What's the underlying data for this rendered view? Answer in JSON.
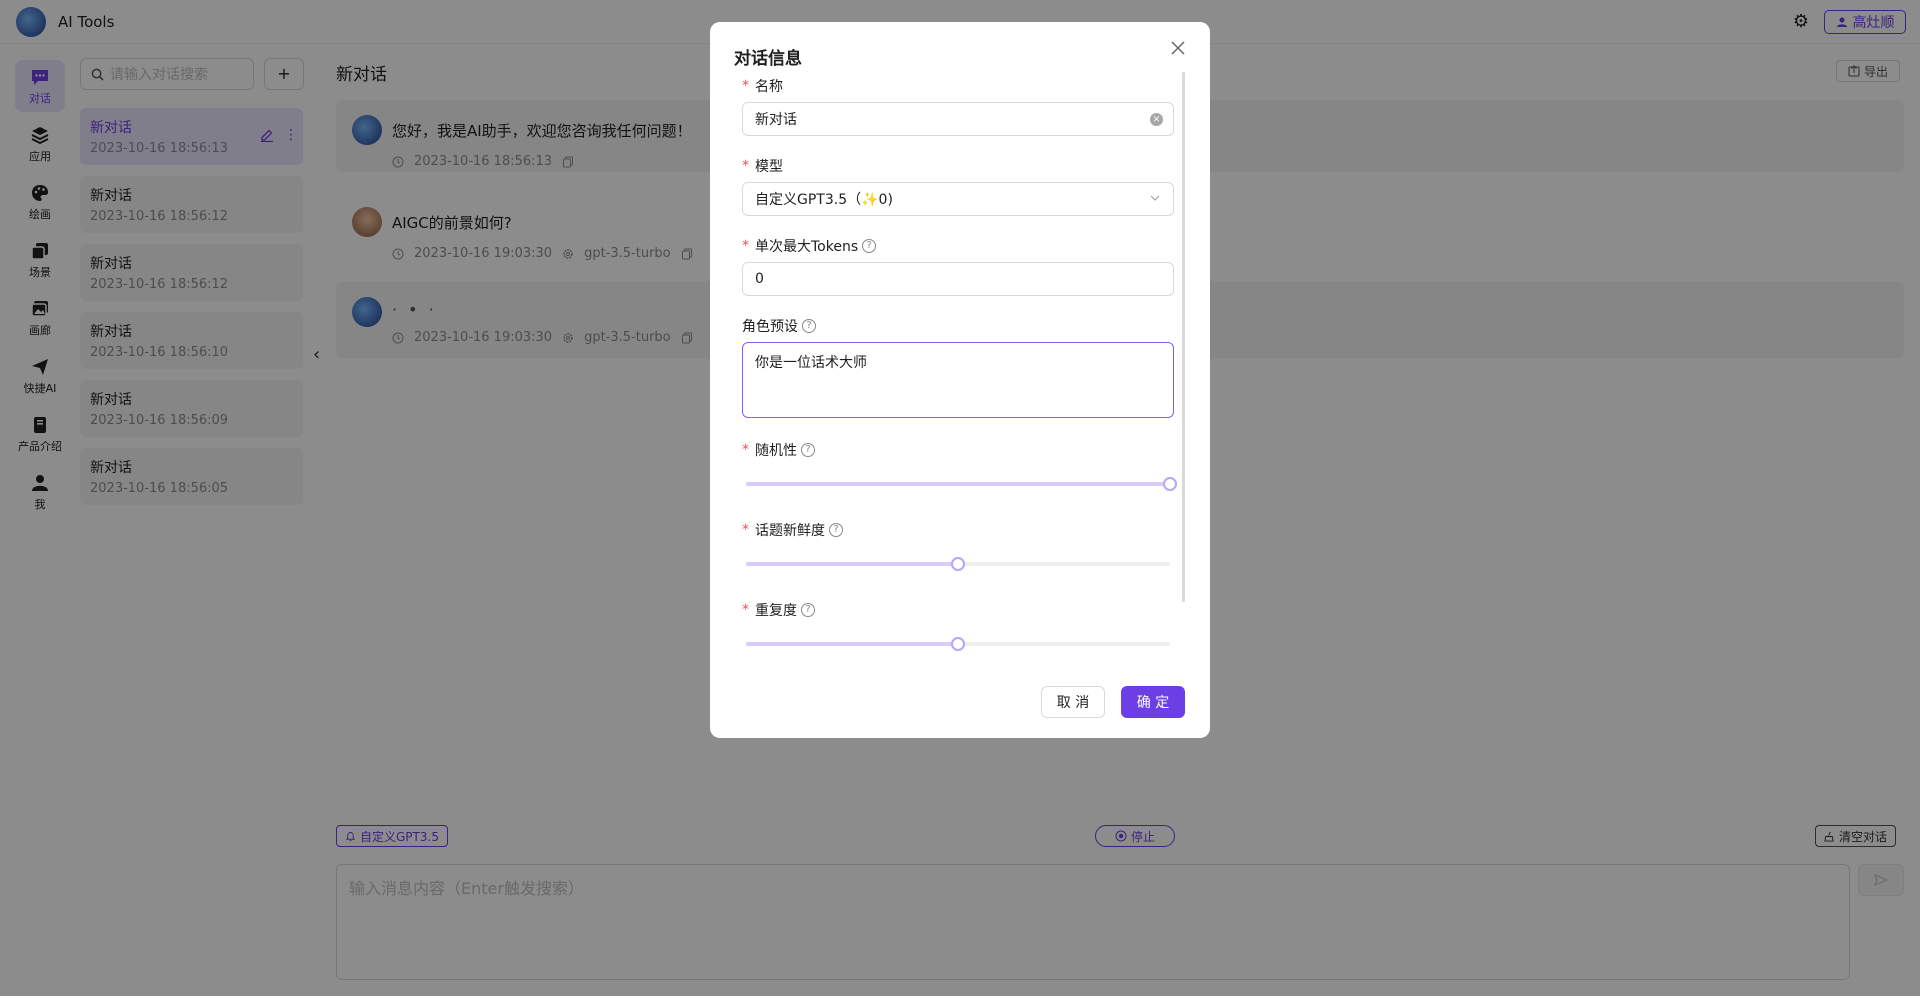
{
  "app": {
    "title": "AI Tools",
    "user_name": "高灶顺"
  },
  "rail": {
    "items": [
      {
        "label": "对话",
        "icon": "chat-icon"
      },
      {
        "label": "应用",
        "icon": "layers-icon"
      },
      {
        "label": "绘画",
        "icon": "palette-icon"
      },
      {
        "label": "场景",
        "icon": "copy-icon"
      },
      {
        "label": "画廊",
        "icon": "gallery-icon"
      },
      {
        "label": "快捷AI",
        "icon": "send-icon"
      },
      {
        "label": "产品介绍",
        "icon": "book-icon"
      },
      {
        "label": "我",
        "icon": "user-icon"
      }
    ]
  },
  "sidebar": {
    "search_placeholder": "请输入对话搜索",
    "add_label": "+",
    "conversations": [
      {
        "title": "新对话",
        "date": "2023-10-16 18:56:13"
      },
      {
        "title": "新对话",
        "date": "2023-10-16 18:56:12"
      },
      {
        "title": "新对话",
        "date": "2023-10-16 18:56:12"
      },
      {
        "title": "新对话",
        "date": "2023-10-16 18:56:10"
      },
      {
        "title": "新对话",
        "date": "2023-10-16 18:56:09"
      },
      {
        "title": "新对话",
        "date": "2023-10-16 18:56:05"
      }
    ]
  },
  "chat": {
    "title": "新对话",
    "export_label": "导出",
    "messages": [
      {
        "role": "bot",
        "text": "您好，我是AI助手，欢迎您咨询我任何问题！",
        "time": "2023-10-16 18:56:13",
        "model": ""
      },
      {
        "role": "user",
        "text": "AIGC的前景如何?",
        "time": "2023-10-16 19:03:30",
        "model": "gpt-3.5-turbo"
      },
      {
        "role": "bot",
        "text": "· • ·",
        "time": "2023-10-16 19:03:30",
        "model": "gpt-3.5-turbo"
      }
    ],
    "model_badge": "自定义GPT3.5",
    "stop_label": "停止",
    "clear_label": "清空对话",
    "input_placeholder": "输入消息内容（Enter触发搜索）"
  },
  "modal": {
    "title": "对话信息",
    "name": {
      "label": "名称",
      "value": "新对话"
    },
    "model": {
      "label": "模型",
      "value": "自定义GPT3.5（✨0)"
    },
    "max_tokens": {
      "label": "单次最大Tokens",
      "value": "0"
    },
    "role": {
      "label": "角色预设",
      "value": "你是一位话术大师"
    },
    "temperature": {
      "label": "随机性",
      "level": 1.0
    },
    "presence": {
      "label": "话题新鲜度",
      "level": 0.5
    },
    "frequency": {
      "label": "重复度",
      "level": 0.5
    },
    "cancel_label": "取 消",
    "ok_label": "确 定"
  },
  "colors": {
    "accent": "#6b3ee6",
    "accent_light": "#ece6fd",
    "required": "#ff4d4f"
  }
}
